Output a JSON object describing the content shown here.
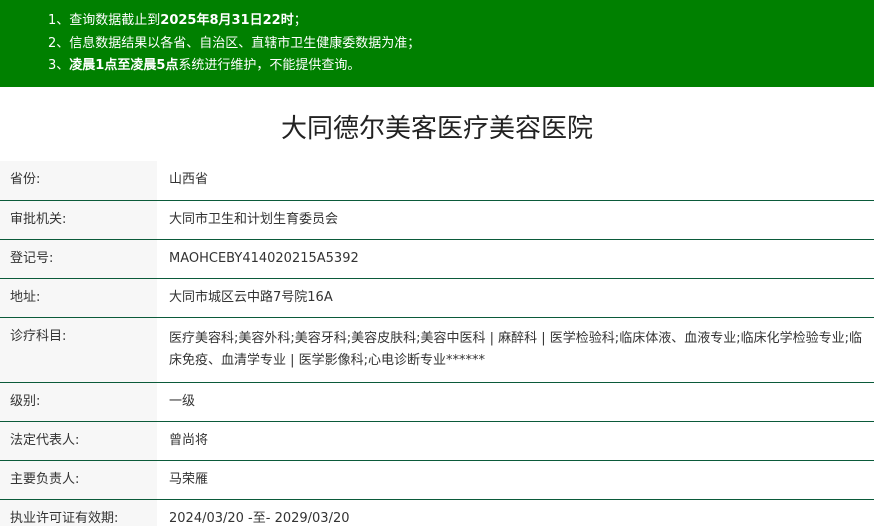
{
  "notice": {
    "line1_prefix": "1、查询数据截止到",
    "line1_bold": "2025年8月31日22时",
    "line1_suffix": "；",
    "line2": "2、信息数据结果以各省、自治区、直辖市卫生健康委数据为准；",
    "line3_prefix": "3、",
    "line3_bold": "凌晨1点至凌晨5点",
    "line3_suffix": "系统进行维护，不能提供查询。"
  },
  "title": "大同德尔美客医疗美容医院",
  "rows": [
    {
      "label": "省份:",
      "value": "山西省"
    },
    {
      "label": "审批机关:",
      "value": "大同市卫生和计划生育委员会"
    },
    {
      "label": "登记号:",
      "value": "MAOHCEBY414020215A5392"
    },
    {
      "label": "地址:",
      "value": "大同市城区云中路7号院16A"
    },
    {
      "label": "诊疗科目:",
      "value": "医疗美容科;美容外科;美容牙科;美容皮肤科;美容中医科 | 麻醉科 | 医学检验科;临床体液、血液专业;临床化学检验专业;临床免疫、血清学专业 | 医学影像科;心电诊断专业******"
    },
    {
      "label": "级别:",
      "value": "一级"
    },
    {
      "label": "法定代表人:",
      "value": "曾尚将"
    },
    {
      "label": "主要负责人:",
      "value": "马荣雁"
    },
    {
      "label": "执业许可证有效期:",
      "value": "2024/03/20 -至- 2029/03/20"
    }
  ]
}
